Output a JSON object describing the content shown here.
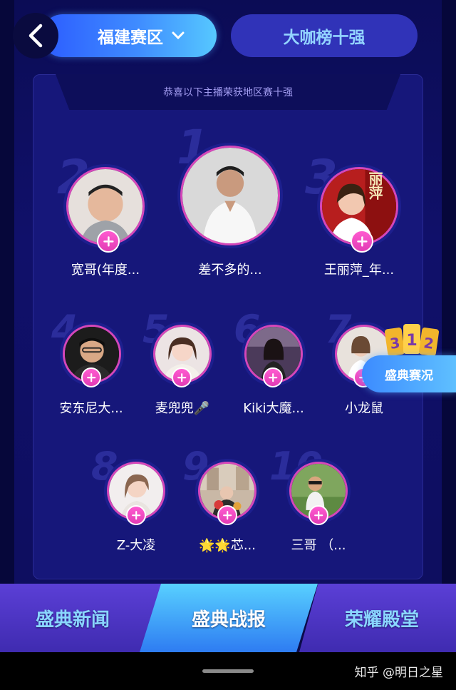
{
  "header": {
    "region_label": "福建赛区",
    "top10_label": "大咖榜十强"
  },
  "panel": {
    "subtitle": "恭喜以下主播荣获地区赛十强"
  },
  "ranks": [
    {
      "rank": "1",
      "name": "差不多的..."
    },
    {
      "rank": "2",
      "name": "宽哥(年度..."
    },
    {
      "rank": "3",
      "name": "王丽萍_年..."
    },
    {
      "rank": "4",
      "name": "安东尼大..."
    },
    {
      "rank": "5",
      "name": "麦兜兜🎤"
    },
    {
      "rank": "6",
      "name": "Kiki大魔..."
    },
    {
      "rank": "7",
      "name": "小龙鼠"
    },
    {
      "rank": "8",
      "name": "Z-大凌"
    },
    {
      "rank": "9",
      "name": "🌟🌟芯..."
    },
    {
      "rank": "10",
      "name": "三哥 （..."
    }
  ],
  "avatar3_text": "丽萍",
  "float_badge": {
    "label": "盛典赛况",
    "calendar_digits": "312"
  },
  "tabs": [
    {
      "label": "盛典新闻"
    },
    {
      "label": "盛典战报"
    },
    {
      "label": "荣耀殿堂"
    }
  ],
  "watermark": "知乎 @明日之星",
  "colors": {
    "accent_pink": "#d547b9",
    "accent_blue": "#3f8cff",
    "panel_bg": "#16177a"
  }
}
